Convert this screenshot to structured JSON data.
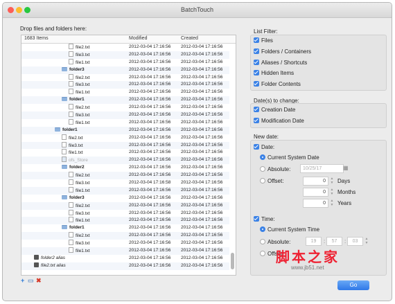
{
  "window": {
    "title": "BatchTouch",
    "traffic_lights": {
      "close": "#fc5f57",
      "minimize": "#fdbc2e",
      "zoom": "#28c840"
    }
  },
  "left": {
    "drop_label": "Drop files and folders here:",
    "columns": {
      "name": "1683 Items",
      "modified": "Modified",
      "created": "Created"
    },
    "rows": [
      {
        "name": "file2.txt",
        "type": "file",
        "indent": 3,
        "modified": "2012-03-04 17:16:56",
        "created": "2012-03-04 17:16:56"
      },
      {
        "name": "file3.txt",
        "type": "file",
        "indent": 3,
        "modified": "2012-03-04 17:16:56",
        "created": "2012-03-04 17:16:56"
      },
      {
        "name": "file1.txt",
        "type": "file",
        "indent": 3,
        "modified": "2012-03-04 17:16:56",
        "created": "2012-03-04 17:16:56"
      },
      {
        "name": "folder3",
        "type": "folder",
        "indent": 2,
        "modified": "2012-03-04 17:16:56",
        "created": "2012-03-04 17:16:56"
      },
      {
        "name": "file2.txt",
        "type": "file",
        "indent": 3,
        "modified": "2012-03-04 17:16:56",
        "created": "2012-03-04 17:16:56"
      },
      {
        "name": "file3.txt",
        "type": "file",
        "indent": 3,
        "modified": "2012-03-04 17:16:56",
        "created": "2012-03-04 17:16:56"
      },
      {
        "name": "file1.txt",
        "type": "file",
        "indent": 3,
        "modified": "2012-03-04 17:16:56",
        "created": "2012-03-04 17:16:56"
      },
      {
        "name": "folder1",
        "type": "folder",
        "indent": 2,
        "modified": "2012-03-04 17:16:56",
        "created": "2012-03-04 17:16:56"
      },
      {
        "name": "file2.txt",
        "type": "file",
        "indent": 3,
        "modified": "2012-03-04 17:16:56",
        "created": "2012-03-04 17:16:56"
      },
      {
        "name": "file3.txt",
        "type": "file",
        "indent": 3,
        "modified": "2012-03-04 17:16:56",
        "created": "2012-03-04 17:16:56"
      },
      {
        "name": "file1.txt",
        "type": "file",
        "indent": 3,
        "modified": "2012-03-04 17:16:56",
        "created": "2012-03-04 17:16:56"
      },
      {
        "name": "folder1",
        "type": "folder",
        "indent": 1,
        "modified": "2012-03-04 17:16:56",
        "created": "2012-03-04 17:16:56"
      },
      {
        "name": "file2.txt",
        "type": "file",
        "indent": 2,
        "modified": "2012-03-04 17:16:56",
        "created": "2012-03-04 17:16:56"
      },
      {
        "name": "file3.txt",
        "type": "file",
        "indent": 2,
        "modified": "2012-03-04 17:16:56",
        "created": "2012-03-04 17:16:56"
      },
      {
        "name": "file1.txt",
        "type": "file",
        "indent": 2,
        "modified": "2012-03-04 17:16:56",
        "created": "2012-03-04 17:16:56"
      },
      {
        "name": "ofs_Store",
        "type": "hidden",
        "indent": 2,
        "modified": "2012-03-04 17:16:56",
        "created": "2012-03-04 17:16:56"
      },
      {
        "name": "folder2",
        "type": "folder",
        "indent": 2,
        "modified": "2012-03-04 17:16:56",
        "created": "2012-03-04 17:16:56"
      },
      {
        "name": "file2.txt",
        "type": "file",
        "indent": 3,
        "modified": "2012-03-04 17:16:56",
        "created": "2012-03-04 17:16:56"
      },
      {
        "name": "file3.txt",
        "type": "file",
        "indent": 3,
        "modified": "2012-03-04 17:16:58",
        "created": "2012-03-04 17:16:56"
      },
      {
        "name": "file1.txt",
        "type": "file",
        "indent": 3,
        "modified": "2012-03-04 17:16:56",
        "created": "2012-03-04 17:16:56"
      },
      {
        "name": "folder3",
        "type": "folder",
        "indent": 2,
        "modified": "2012-03-04 17:16:56",
        "created": "2012-03-04 17:16:56"
      },
      {
        "name": "file2.txt",
        "type": "file",
        "indent": 3,
        "modified": "2012-03-04 17:16:56",
        "created": "2012-03-04 17:16:56"
      },
      {
        "name": "file3.txt",
        "type": "file",
        "indent": 3,
        "modified": "2012-03-04 17:16:56",
        "created": "2012-03-04 17:16:56"
      },
      {
        "name": "file1.txt",
        "type": "file",
        "indent": 3,
        "modified": "2012-03-04 17:16:56",
        "created": "2012-03-04 17:16:56"
      },
      {
        "name": "folder1",
        "type": "folder",
        "indent": 2,
        "modified": "2012-03-04 17:16:56",
        "created": "2012-03-04 17:16:56"
      },
      {
        "name": "file2.txt",
        "type": "file",
        "indent": 3,
        "modified": "2012-03-04 17:16:56",
        "created": "2012-03-04 17:16:56"
      },
      {
        "name": "file3.txt",
        "type": "file",
        "indent": 3,
        "modified": "2012-03-04 17:16:56",
        "created": "2012-03-04 17:16:56"
      },
      {
        "name": "file1.txt",
        "type": "file",
        "indent": 3,
        "modified": "2012-03-04 17:16:56",
        "created": "2012-03-04 17:16:56"
      },
      {
        "name": "folder2 alias",
        "type": "alias",
        "indent": 0,
        "modified": "2012-03-04 17:16:56",
        "created": "2012-03-04 17:16:56"
      },
      {
        "name": "file2.txt alias",
        "type": "alias",
        "indent": 0,
        "modified": "2012-03-04 17:16:56",
        "created": "2012-03-04 17:16:56"
      }
    ],
    "bottom_icons": [
      "add-icon",
      "add-folder-icon",
      "remove-icon"
    ]
  },
  "filter": {
    "label": "List Filter:",
    "items": [
      "Files",
      "Folders / Containers",
      "Aliases / Shortcuts",
      "Hidden Items",
      "Folder Contents"
    ]
  },
  "dates": {
    "label": "Date(s) to change:",
    "items": [
      "Creation Date",
      "Modification Date"
    ]
  },
  "newdate": {
    "label": "New date:",
    "date_check": "Date:",
    "current": "Current System Date",
    "absolute": "Absolute:",
    "absolute_value": "10/25/17",
    "offset": "Offset:",
    "offset_values": [
      "0",
      "0",
      "0"
    ],
    "offset_units": [
      "Days",
      "Months",
      "Years"
    ],
    "time_check": "Time:",
    "current_time": "Current System Time",
    "time_absolute": "Absolute:",
    "time_values": [
      "19",
      "57",
      "03"
    ],
    "time_offset": "Offset:"
  },
  "go_label": "Go",
  "watermark": {
    "text": "脚本之家",
    "url": "www.jb51.net"
  }
}
